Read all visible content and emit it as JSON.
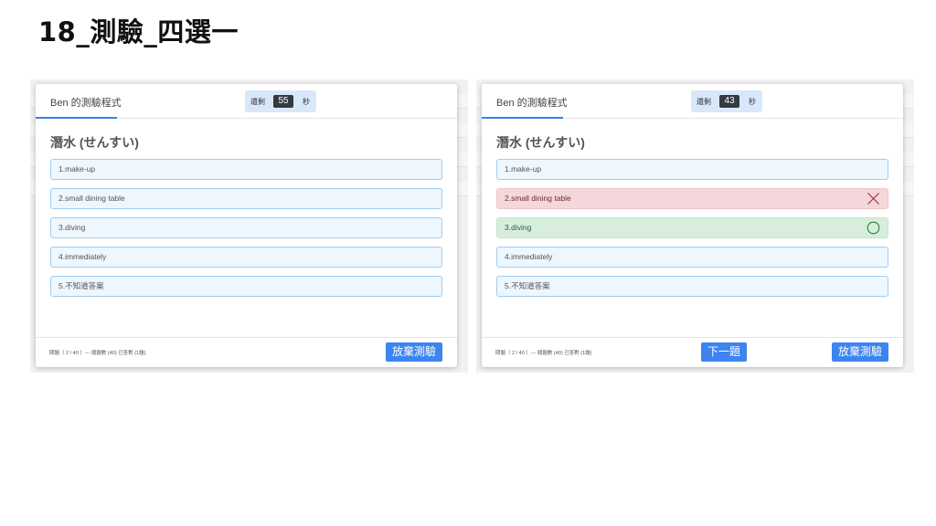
{
  "slide_title": "18_測驗_四選一",
  "panels": [
    {
      "program_name": "Ben 的測驗程式",
      "timer_prefix": "還剩",
      "timer_value": "55",
      "timer_suffix": "秒",
      "question": "潛水 (せんすい)",
      "options": [
        "1.make-up",
        "2.small dining table",
        "3.diving",
        "4.immediately",
        "5.不知道答案"
      ],
      "footer": "問題（ 2 / 40 ）--- 總題數 (40) 已答對 (1題)",
      "giveup_label": "放棄測驗"
    },
    {
      "program_name": "Ben 的測驗程式",
      "timer_prefix": "還剩",
      "timer_value": "43",
      "timer_suffix": "秒",
      "question": "潛水 (せんすい)",
      "options": [
        "1.make-up",
        "2.small dining table",
        "3.diving",
        "4.immediately",
        "5.不知道答案"
      ],
      "option_states": [
        "normal",
        "wrong",
        "correct",
        "normal",
        "normal"
      ],
      "footer": "問題（ 2 / 40 ）--- 總題數 (40) 已答對 (1題)",
      "next_label": "下一題",
      "giveup_label": "放棄測驗"
    }
  ],
  "colors": {
    "accent": "#3d84f0",
    "option_bg": "#eef6fe",
    "option_border": "#9fcdf2",
    "wrong_bg": "#f4d7da",
    "correct_bg": "#d7eedc"
  }
}
